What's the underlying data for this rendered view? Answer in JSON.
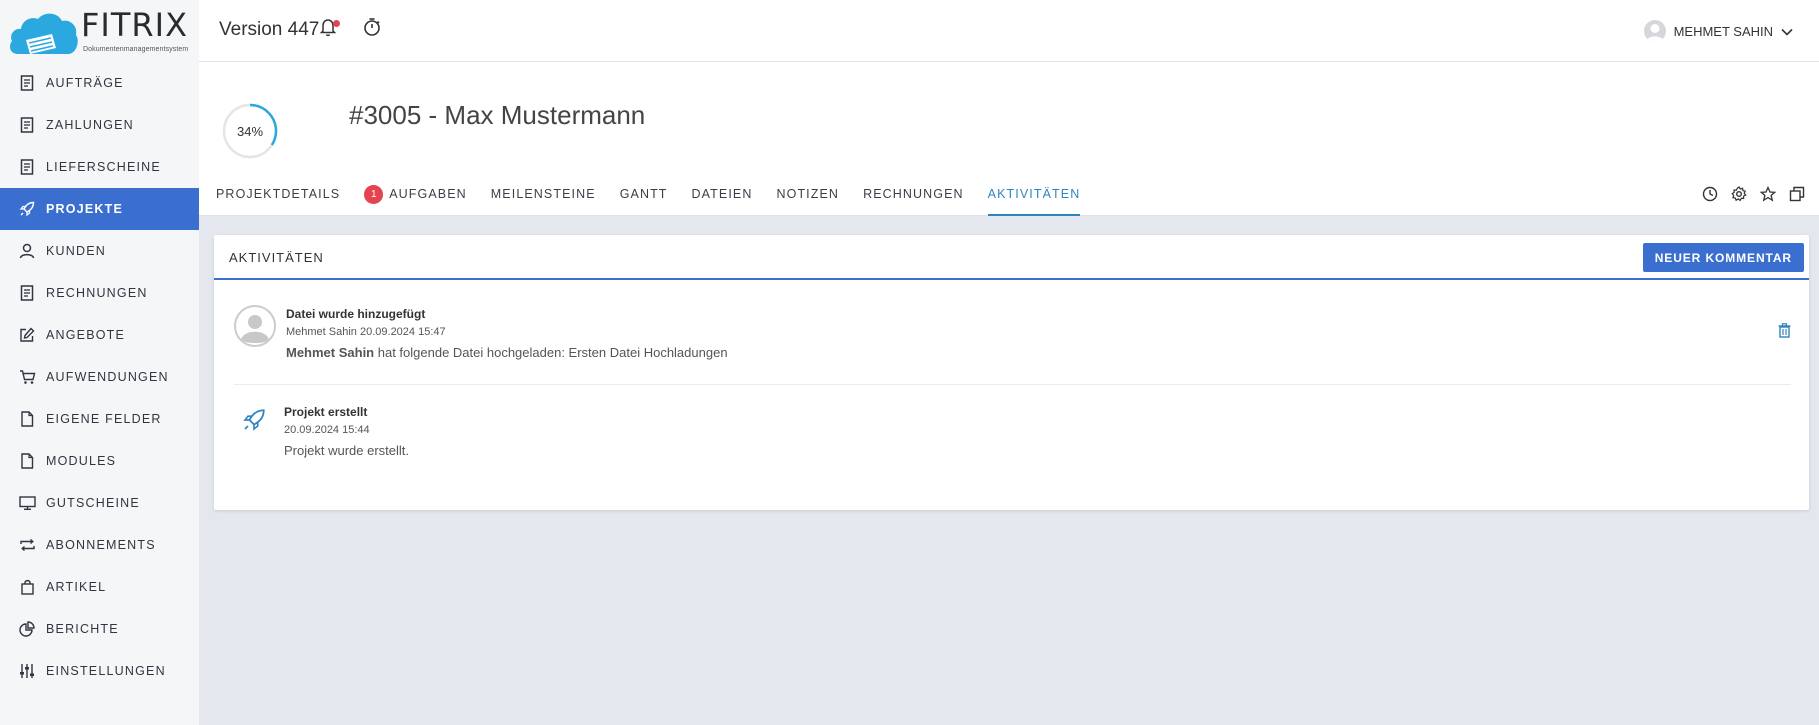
{
  "brand": {
    "name": "FITRIX",
    "tagline": "Dokumentenmanagementsystem",
    "accent": "#3a6fd0",
    "cloud_color": "#2aa8df"
  },
  "sidebar": {
    "items": [
      {
        "label": "AUFTRÄGE",
        "icon": "document-icon"
      },
      {
        "label": "ZAHLUNGEN",
        "icon": "document-icon"
      },
      {
        "label": "LIEFERSCHEINE",
        "icon": "document-icon"
      },
      {
        "label": "PROJEKTE",
        "icon": "rocket-icon",
        "active": true
      },
      {
        "label": "KUNDEN",
        "icon": "user-icon"
      },
      {
        "label": "RECHNUNGEN",
        "icon": "document-icon"
      },
      {
        "label": "ANGEBOTE",
        "icon": "edit-icon"
      },
      {
        "label": "AUFWENDUNGEN",
        "icon": "cart-icon"
      },
      {
        "label": "EIGENE FELDER",
        "icon": "file-icon"
      },
      {
        "label": "MODULES",
        "icon": "file-icon"
      },
      {
        "label": "GUTSCHEINE",
        "icon": "monitor-icon"
      },
      {
        "label": "ABONNEMENTS",
        "icon": "repeat-icon"
      },
      {
        "label": "ARTIKEL",
        "icon": "bag-icon"
      },
      {
        "label": "BERICHTE",
        "icon": "pie-chart-icon"
      },
      {
        "label": "EINSTELLUNGEN",
        "icon": "sliders-icon"
      }
    ]
  },
  "header": {
    "version": "Version 447",
    "user_name": "MEHMET SAHIN"
  },
  "project": {
    "progress_label": "34%",
    "progress": 0.34,
    "number": "#3005",
    "name": "- Max Mustermann"
  },
  "tabs": [
    {
      "label": "PROJEKTDETAILS"
    },
    {
      "label": "AUFGABEN",
      "badge": "1"
    },
    {
      "label": "MEILENSTEINE"
    },
    {
      "label": "GANTT"
    },
    {
      "label": "DATEIEN"
    },
    {
      "label": "NOTIZEN"
    },
    {
      "label": "RECHNUNGEN"
    },
    {
      "label": "AKTIVITÄTEN",
      "active": true
    }
  ],
  "activities_card": {
    "title": "AKTIVITÄTEN",
    "new_comment_label": "NEUER KOMMENTAR",
    "items": [
      {
        "title": "Datei wurde hinzugefügt",
        "meta": "Mehmet Sahin 20.09.2024 15:47",
        "author": "Mehmet Sahin",
        "text": " hat folgende Datei hochgeladen: Ersten Datei Hochladungen"
      },
      {
        "title": "Projekt erstellt",
        "meta": "20.09.2024 15:44",
        "text": "Projekt wurde erstellt."
      }
    ]
  }
}
